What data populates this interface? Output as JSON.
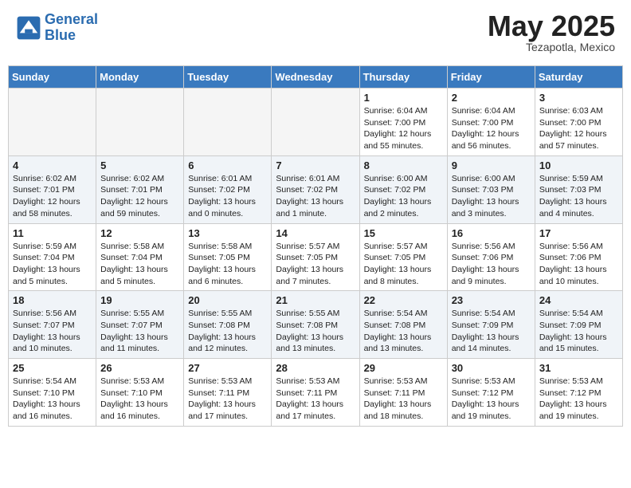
{
  "header": {
    "logo_line1": "General",
    "logo_line2": "Blue",
    "month": "May 2025",
    "location": "Tezapotla, Mexico"
  },
  "days_of_week": [
    "Sunday",
    "Monday",
    "Tuesday",
    "Wednesday",
    "Thursday",
    "Friday",
    "Saturday"
  ],
  "weeks": [
    [
      {
        "day": "",
        "info": ""
      },
      {
        "day": "",
        "info": ""
      },
      {
        "day": "",
        "info": ""
      },
      {
        "day": "",
        "info": ""
      },
      {
        "day": "1",
        "info": "Sunrise: 6:04 AM\nSunset: 7:00 PM\nDaylight: 12 hours\nand 55 minutes."
      },
      {
        "day": "2",
        "info": "Sunrise: 6:04 AM\nSunset: 7:00 PM\nDaylight: 12 hours\nand 56 minutes."
      },
      {
        "day": "3",
        "info": "Sunrise: 6:03 AM\nSunset: 7:00 PM\nDaylight: 12 hours\nand 57 minutes."
      }
    ],
    [
      {
        "day": "4",
        "info": "Sunrise: 6:02 AM\nSunset: 7:01 PM\nDaylight: 12 hours\nand 58 minutes."
      },
      {
        "day": "5",
        "info": "Sunrise: 6:02 AM\nSunset: 7:01 PM\nDaylight: 12 hours\nand 59 minutes."
      },
      {
        "day": "6",
        "info": "Sunrise: 6:01 AM\nSunset: 7:02 PM\nDaylight: 13 hours\nand 0 minutes."
      },
      {
        "day": "7",
        "info": "Sunrise: 6:01 AM\nSunset: 7:02 PM\nDaylight: 13 hours\nand 1 minute."
      },
      {
        "day": "8",
        "info": "Sunrise: 6:00 AM\nSunset: 7:02 PM\nDaylight: 13 hours\nand 2 minutes."
      },
      {
        "day": "9",
        "info": "Sunrise: 6:00 AM\nSunset: 7:03 PM\nDaylight: 13 hours\nand 3 minutes."
      },
      {
        "day": "10",
        "info": "Sunrise: 5:59 AM\nSunset: 7:03 PM\nDaylight: 13 hours\nand 4 minutes."
      }
    ],
    [
      {
        "day": "11",
        "info": "Sunrise: 5:59 AM\nSunset: 7:04 PM\nDaylight: 13 hours\nand 5 minutes."
      },
      {
        "day": "12",
        "info": "Sunrise: 5:58 AM\nSunset: 7:04 PM\nDaylight: 13 hours\nand 5 minutes."
      },
      {
        "day": "13",
        "info": "Sunrise: 5:58 AM\nSunset: 7:05 PM\nDaylight: 13 hours\nand 6 minutes."
      },
      {
        "day": "14",
        "info": "Sunrise: 5:57 AM\nSunset: 7:05 PM\nDaylight: 13 hours\nand 7 minutes."
      },
      {
        "day": "15",
        "info": "Sunrise: 5:57 AM\nSunset: 7:05 PM\nDaylight: 13 hours\nand 8 minutes."
      },
      {
        "day": "16",
        "info": "Sunrise: 5:56 AM\nSunset: 7:06 PM\nDaylight: 13 hours\nand 9 minutes."
      },
      {
        "day": "17",
        "info": "Sunrise: 5:56 AM\nSunset: 7:06 PM\nDaylight: 13 hours\nand 10 minutes."
      }
    ],
    [
      {
        "day": "18",
        "info": "Sunrise: 5:56 AM\nSunset: 7:07 PM\nDaylight: 13 hours\nand 10 minutes."
      },
      {
        "day": "19",
        "info": "Sunrise: 5:55 AM\nSunset: 7:07 PM\nDaylight: 13 hours\nand 11 minutes."
      },
      {
        "day": "20",
        "info": "Sunrise: 5:55 AM\nSunset: 7:08 PM\nDaylight: 13 hours\nand 12 minutes."
      },
      {
        "day": "21",
        "info": "Sunrise: 5:55 AM\nSunset: 7:08 PM\nDaylight: 13 hours\nand 13 minutes."
      },
      {
        "day": "22",
        "info": "Sunrise: 5:54 AM\nSunset: 7:08 PM\nDaylight: 13 hours\nand 13 minutes."
      },
      {
        "day": "23",
        "info": "Sunrise: 5:54 AM\nSunset: 7:09 PM\nDaylight: 13 hours\nand 14 minutes."
      },
      {
        "day": "24",
        "info": "Sunrise: 5:54 AM\nSunset: 7:09 PM\nDaylight: 13 hours\nand 15 minutes."
      }
    ],
    [
      {
        "day": "25",
        "info": "Sunrise: 5:54 AM\nSunset: 7:10 PM\nDaylight: 13 hours\nand 16 minutes."
      },
      {
        "day": "26",
        "info": "Sunrise: 5:53 AM\nSunset: 7:10 PM\nDaylight: 13 hours\nand 16 minutes."
      },
      {
        "day": "27",
        "info": "Sunrise: 5:53 AM\nSunset: 7:11 PM\nDaylight: 13 hours\nand 17 minutes."
      },
      {
        "day": "28",
        "info": "Sunrise: 5:53 AM\nSunset: 7:11 PM\nDaylight: 13 hours\nand 17 minutes."
      },
      {
        "day": "29",
        "info": "Sunrise: 5:53 AM\nSunset: 7:11 PM\nDaylight: 13 hours\nand 18 minutes."
      },
      {
        "day": "30",
        "info": "Sunrise: 5:53 AM\nSunset: 7:12 PM\nDaylight: 13 hours\nand 19 minutes."
      },
      {
        "day": "31",
        "info": "Sunrise: 5:53 AM\nSunset: 7:12 PM\nDaylight: 13 hours\nand 19 minutes."
      }
    ]
  ]
}
